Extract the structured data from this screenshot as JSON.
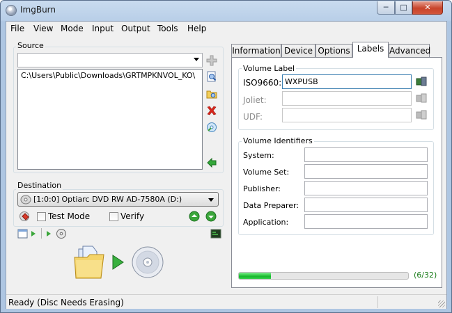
{
  "window": {
    "title": "ImgBurn",
    "controls": {
      "minimize": "─",
      "maximize": "□",
      "close": "✕"
    }
  },
  "menu": [
    "File",
    "View",
    "Mode",
    "Input",
    "Output",
    "Tools",
    "Help"
  ],
  "source": {
    "group_label": "Source",
    "combo_value": "",
    "files": [
      "C:\\Users\\Public\\Downloads\\GRTMPKNVOL_KO\\"
    ],
    "icons": [
      "add-icon",
      "browse-files-icon",
      "browse-folder-icon",
      "remove-icon",
      "calculate-icon",
      "build-icon"
    ]
  },
  "destination": {
    "group_label": "Destination",
    "device": "[1:0:0] Optiarc DVD RW AD-7580A (D:)",
    "test_mode_label": "Test Mode",
    "test_mode_checked": false,
    "verify_label": "Verify",
    "verify_checked": false
  },
  "tabs": [
    {
      "label": "Information",
      "active": false
    },
    {
      "label": "Device",
      "active": false
    },
    {
      "label": "Options",
      "active": false
    },
    {
      "label": "Labels",
      "active": true
    },
    {
      "label": "Advanced",
      "active": false
    }
  ],
  "volume_label": {
    "group_label": "Volume Label",
    "iso9660_label": "ISO9660:",
    "iso9660_value": "WXPUSB",
    "joliet_label": "Joliet:",
    "joliet_value": "",
    "udf_label": "UDF:",
    "udf_value": ""
  },
  "volume_identifiers": {
    "group_label": "Volume Identifiers",
    "fields": [
      {
        "label": "System:",
        "value": ""
      },
      {
        "label": "Volume Set:",
        "value": ""
      },
      {
        "label": "Publisher:",
        "value": ""
      },
      {
        "label": "Data Preparer:",
        "value": ""
      },
      {
        "label": "Application:",
        "value": ""
      }
    ]
  },
  "progress": {
    "fraction": 0.1875,
    "text": "(6/32)"
  },
  "status": {
    "text": "Ready (Disc Needs Erasing)"
  }
}
